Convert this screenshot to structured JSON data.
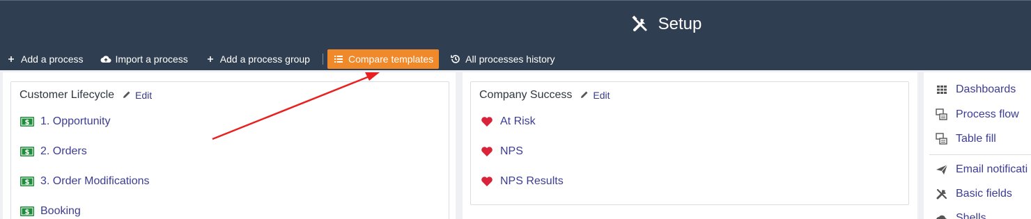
{
  "header": {
    "title": "Setup",
    "title_icon": "tools-icon",
    "bg_color": "#2f3e50"
  },
  "toolbar": {
    "add_process": "Add a process",
    "import_process": "Import a process",
    "add_group": "Add a process group",
    "compare_templates": "Compare templates",
    "history": "All processes history",
    "accent_color": "#f0892a"
  },
  "groups": [
    {
      "title": "Customer Lifecycle",
      "edit_label": "Edit",
      "items": [
        {
          "label": "1. Opportunity",
          "icon": "money-icon"
        },
        {
          "label": "2. Orders",
          "icon": "money-icon"
        },
        {
          "label": "3. Order Modifications",
          "icon": "money-icon"
        },
        {
          "label": "Booking",
          "icon": "money-icon"
        }
      ]
    },
    {
      "title": "Company Success",
      "edit_label": "Edit",
      "items": [
        {
          "label": "At Risk",
          "icon": "heart-icon"
        },
        {
          "label": "NPS",
          "icon": "heart-icon"
        },
        {
          "label": "NPS Results",
          "icon": "heart-icon"
        }
      ]
    }
  ],
  "sidebar": {
    "items": [
      {
        "label": "Dashboards",
        "icon": "grid-icon"
      },
      {
        "label": "Process flow",
        "icon": "flow-icon"
      },
      {
        "label": "Table fill",
        "icon": "table-fill-icon"
      },
      {
        "label": "Email notificati",
        "icon": "paper-plane-icon"
      },
      {
        "label": "Basic fields",
        "icon": "tools-icon"
      },
      {
        "label": "Shells",
        "icon": "cloud-icon"
      }
    ]
  },
  "annotation_color": "#e8201f"
}
